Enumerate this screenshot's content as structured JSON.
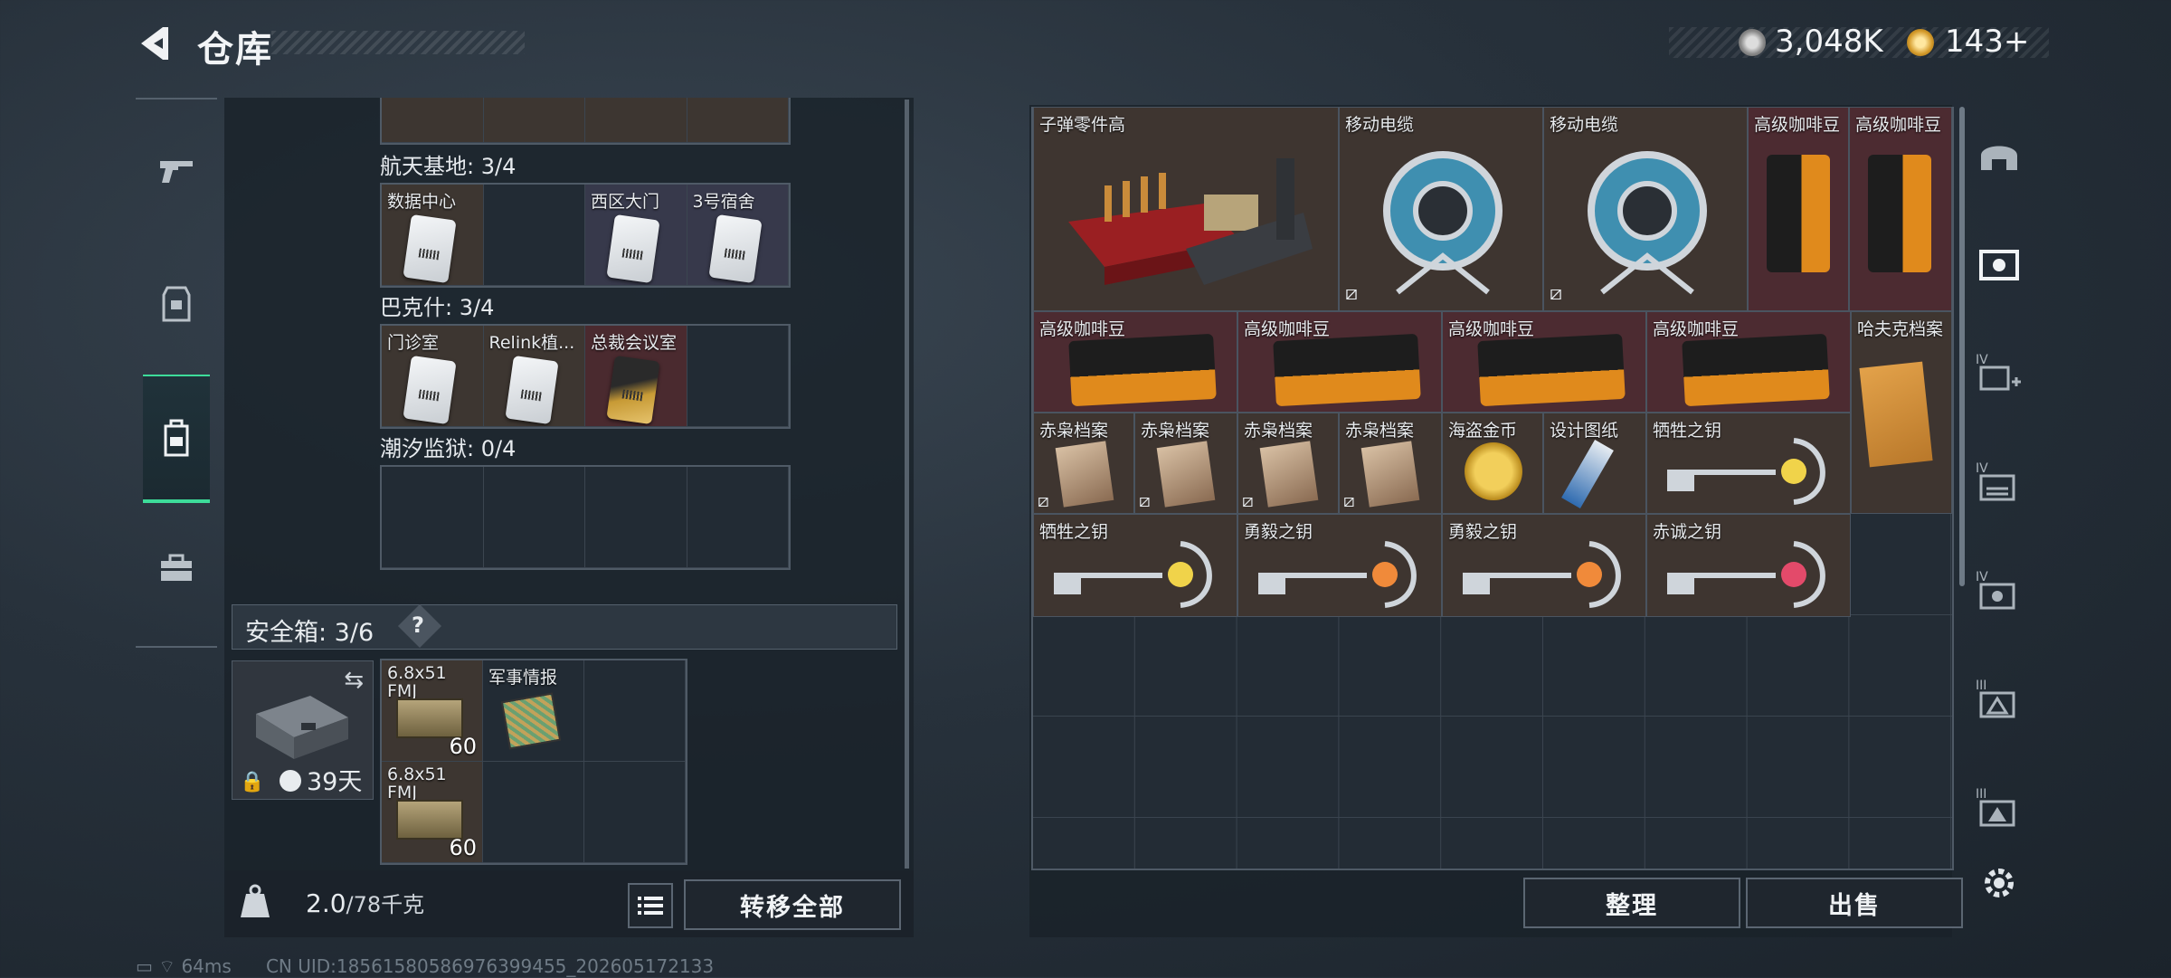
{
  "header": {
    "title": "仓库",
    "money": "3,048K",
    "coupon": "143+"
  },
  "left_rail": {
    "items": [
      "gun-icon",
      "armor-icon",
      "backpack-icon",
      "toolbox-icon"
    ]
  },
  "keycards": {
    "top_row": [
      {
        "label": ""
      },
      {
        "label": ""
      },
      {
        "label": ""
      },
      {
        "label": ""
      }
    ],
    "sections": [
      {
        "title": "航天基地: 3/4",
        "cells": [
          {
            "label": "数据中心",
            "tint": "brown"
          },
          {
            "label": "",
            "tint": "none"
          },
          {
            "label": "西区大门",
            "tint": "blue"
          },
          {
            "label": "3号宿舍",
            "tint": "blue"
          }
        ]
      },
      {
        "title": "巴克什: 3/4",
        "cells": [
          {
            "label": "门诊室",
            "tint": "brown"
          },
          {
            "label": "Relink植...",
            "tint": "brown"
          },
          {
            "label": "总裁会议室",
            "tint": "red"
          },
          {
            "label": "",
            "tint": "none"
          }
        ]
      },
      {
        "title": "潮汐监狱: 0/4",
        "cells": [
          {
            "label": ""
          },
          {
            "label": ""
          },
          {
            "label": ""
          },
          {
            "label": ""
          }
        ]
      }
    ]
  },
  "safe_box": {
    "title": "安全箱: 3/6",
    "help": "?",
    "timer": "39天",
    "items": [
      {
        "label": "6.8x51 FMJ",
        "qty": "60"
      },
      {
        "label": "军事情报",
        "qty": ""
      },
      {
        "label": "6.8x51 FMJ",
        "qty": "60"
      }
    ]
  },
  "left_bottom": {
    "weight_current": "2.0",
    "weight_max": "/78千克",
    "transfer_all": "转移全部"
  },
  "storage_items": [
    {
      "label": "子弹零件高",
      "tint": "brown"
    },
    {
      "label": "移动电缆",
      "tint": "brown"
    },
    {
      "label": "移动电缆",
      "tint": "brown"
    },
    {
      "label": "高级咖啡豆",
      "tint": "red"
    },
    {
      "label": "高级咖啡豆",
      "tint": "red"
    },
    {
      "label": "高级咖啡豆",
      "tint": "red"
    },
    {
      "label": "高级咖啡豆",
      "tint": "red"
    },
    {
      "label": "高级咖啡豆",
      "tint": "red"
    },
    {
      "label": "高级咖啡豆",
      "tint": "red"
    },
    {
      "label": "哈夫克档案",
      "tint": "brown"
    },
    {
      "label": "赤枭档案",
      "tint": "brown"
    },
    {
      "label": "赤枭档案",
      "tint": "brown"
    },
    {
      "label": "赤枭档案",
      "tint": "brown"
    },
    {
      "label": "赤枭档案",
      "tint": "brown"
    },
    {
      "label": "海盗金币",
      "tint": "brown"
    },
    {
      "label": "设计图纸",
      "tint": "brown"
    },
    {
      "label": "牺牲之钥",
      "tint": "brown"
    },
    {
      "label": "牺牲之钥",
      "tint": "brown"
    },
    {
      "label": "勇毅之钥",
      "tint": "brown"
    },
    {
      "label": "勇毅之钥",
      "tint": "brown"
    },
    {
      "label": "赤诚之钥",
      "tint": "brown"
    }
  ],
  "right_bottom": {
    "sort": "整理",
    "sell": "出售"
  },
  "right_rail": {
    "tabs": [
      "helmet-icon",
      "armor-storage-icon",
      "iv-add-icon",
      "iv-storage-icon",
      "iv-armor-icon",
      "iii-backpack-icon",
      "iii-storage-icon"
    ],
    "levels": [
      "IV",
      "IV",
      "IV",
      "III",
      "III"
    ]
  },
  "status_bar": {
    "ping": "64ms",
    "uid": "CN UID:18561580586976399455_202605172133"
  }
}
